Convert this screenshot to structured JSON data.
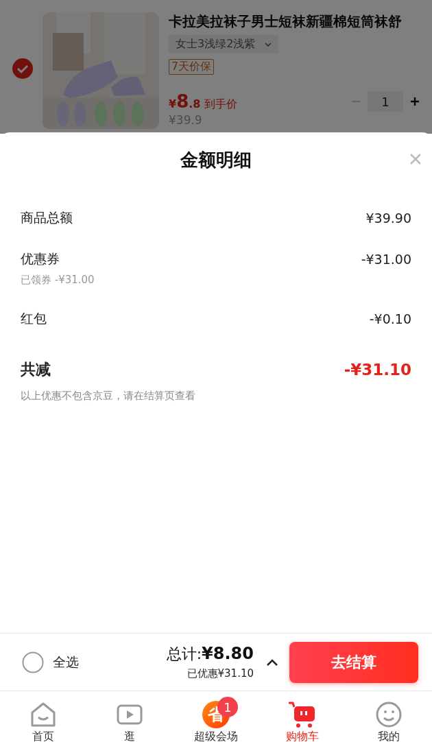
{
  "product": {
    "selected": true,
    "title": "卡拉美拉袜子男士短袜新疆棉短筒袜舒",
    "variant": "女士3浅绿2浅紫",
    "tag": "7天价保",
    "price_symbol": "¥",
    "price_int": "8",
    "price_dec": ".8",
    "price_note": "到手价",
    "original_price": "¥39.9",
    "quantity": "1"
  },
  "sheet": {
    "title": "金额明细",
    "rows": [
      {
        "kind": "item",
        "label": "商品总额",
        "value": "¥39.90"
      },
      {
        "kind": "item",
        "label": "优惠券",
        "value": "-¥31.00",
        "sub": "已领券 -¥31.00"
      },
      {
        "kind": "item",
        "label": "红包",
        "value": "-¥0.10"
      },
      {
        "kind": "total",
        "label": "共减",
        "value": "-¥31.10"
      }
    ],
    "note": "以上优惠不包含京豆，请在结算页查看"
  },
  "checkout_bar": {
    "select_all": {
      "label": "全选",
      "checked": false
    },
    "total_label": "总计:",
    "total": "¥8.80",
    "saved": "已优惠¥31.10",
    "button": "去结算"
  },
  "tabs": [
    {
      "kind": "home",
      "label": "首页",
      "selected": false
    },
    {
      "kind": "video",
      "label": "逛",
      "selected": false
    },
    {
      "kind": "save",
      "icon_text": "省",
      "label": "超级会场",
      "selected": false,
      "badge": "1"
    },
    {
      "kind": "cart",
      "label": "购物车",
      "selected": true
    },
    {
      "kind": "smile",
      "label": "我的",
      "selected": false
    }
  ]
}
